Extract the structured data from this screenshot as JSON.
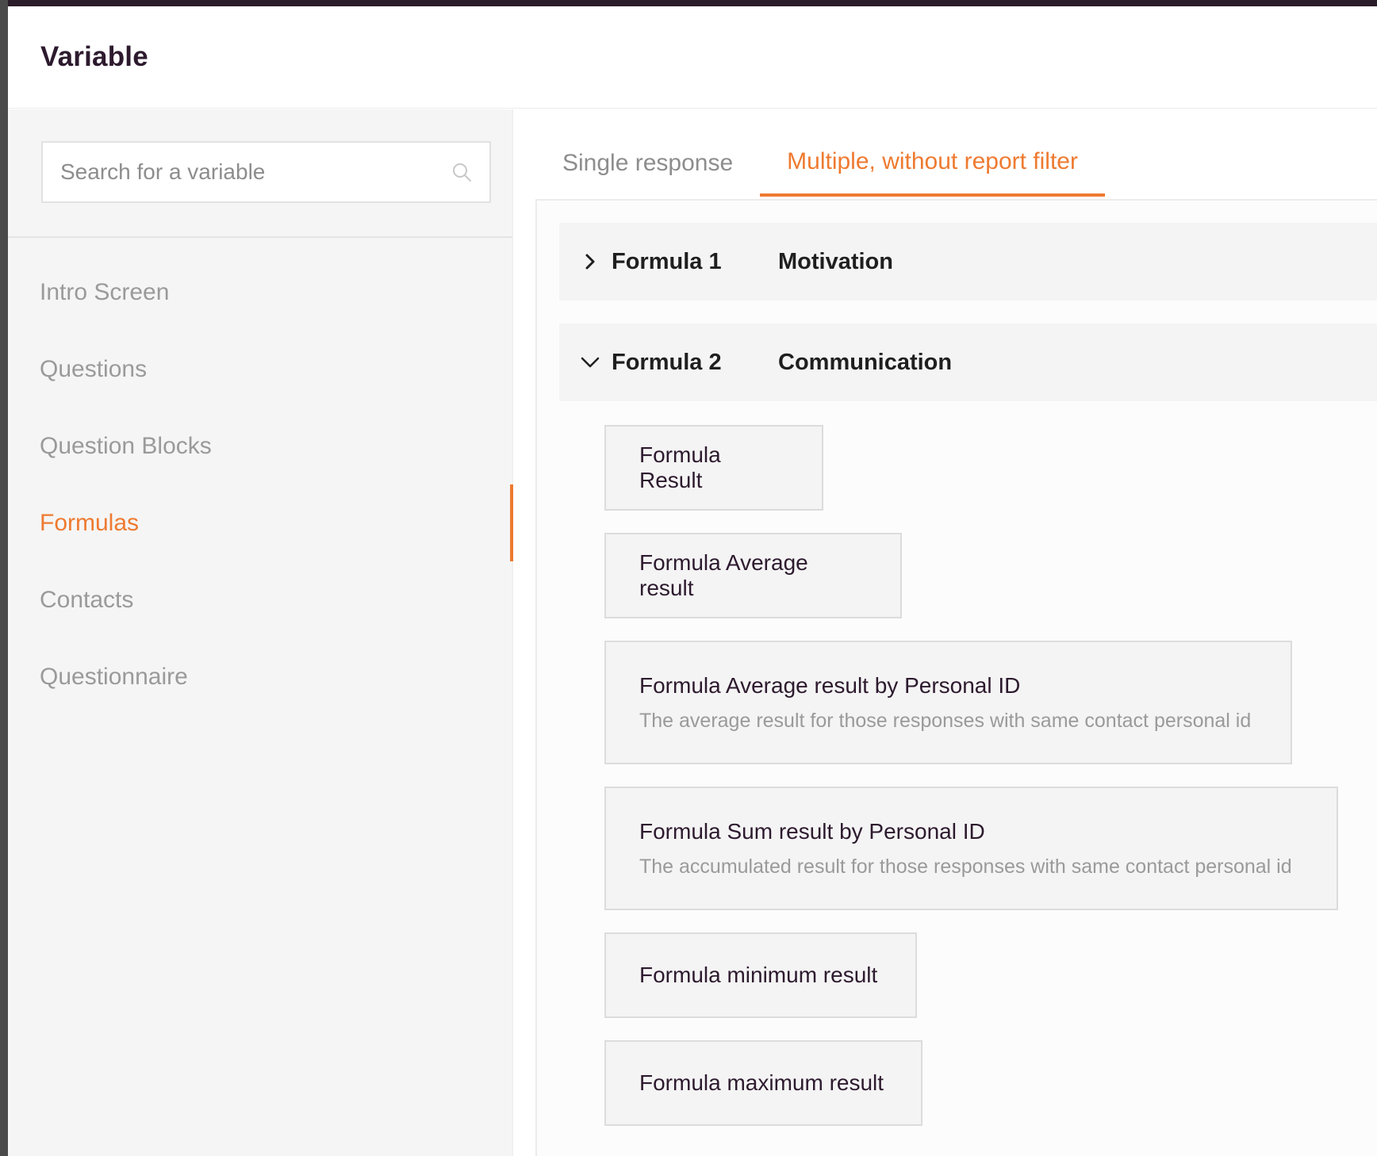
{
  "modal": {
    "title": "Variable"
  },
  "search": {
    "placeholder": "Search for a variable",
    "value": ""
  },
  "sidebar": {
    "items": [
      {
        "label": "Intro Screen",
        "active": false
      },
      {
        "label": "Questions",
        "active": false
      },
      {
        "label": "Question Blocks",
        "active": false
      },
      {
        "label": "Formulas",
        "active": true
      },
      {
        "label": "Contacts",
        "active": false
      },
      {
        "label": "Questionnaire",
        "active": false
      }
    ]
  },
  "tabs": [
    {
      "label": "Single response",
      "active": false
    },
    {
      "label": "Multiple, without report filter",
      "active": true
    }
  ],
  "formulas": [
    {
      "name": "Formula 1",
      "description": "Motivation",
      "expanded": false,
      "chevron": "chevron-right-icon"
    },
    {
      "name": "Formula 2",
      "description": "Communication",
      "expanded": true,
      "chevron": "chevron-down-icon"
    }
  ],
  "variables": [
    {
      "title": "Formula Result",
      "description": ""
    },
    {
      "title": "Formula Average result",
      "description": ""
    },
    {
      "title": "Formula Average result by Personal ID",
      "description": "The average result for those responses with same contact personal id"
    },
    {
      "title": "Formula Sum result by Personal ID",
      "description": "The accumulated result for those responses with same contact personal id"
    },
    {
      "title": "Formula minimum result",
      "description": ""
    },
    {
      "title": "Formula maximum result",
      "description": ""
    }
  ],
  "colors": {
    "accent": "#ee7a30",
    "title": "#2d1a2e",
    "muted": "#9a9a9a"
  }
}
